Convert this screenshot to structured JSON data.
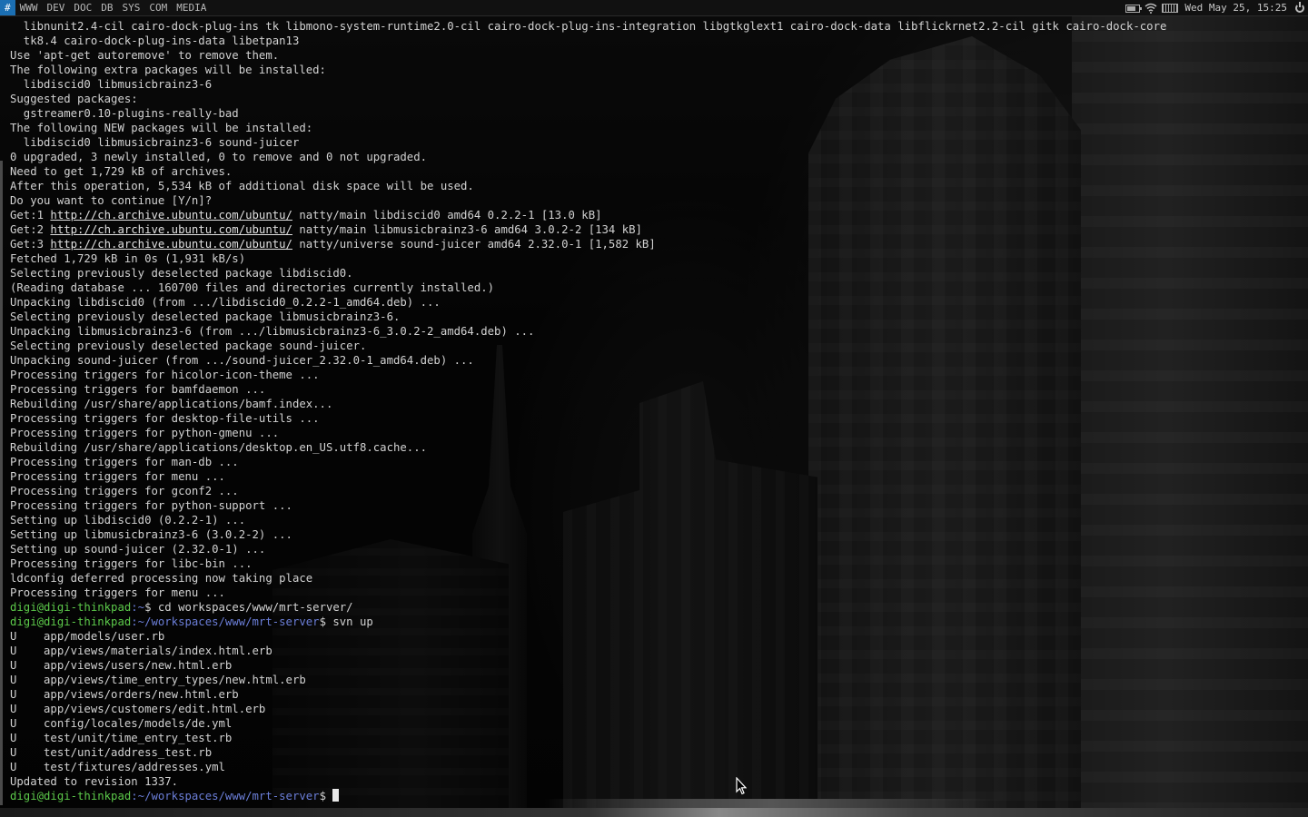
{
  "workspaces": [
    {
      "label": "#",
      "active": true
    },
    {
      "label": "WWW",
      "active": false
    },
    {
      "label": "DEV",
      "active": false
    },
    {
      "label": "DOC",
      "active": false
    },
    {
      "label": "DB",
      "active": false
    },
    {
      "label": "SYS",
      "active": false
    },
    {
      "label": "COM",
      "active": false
    },
    {
      "label": "MEDIA",
      "active": false
    }
  ],
  "tray": {
    "clock": "Wed May 25, 15:25",
    "icons": [
      "battery-icon",
      "wifi-icon",
      "keyboard-icon",
      "power-icon"
    ]
  },
  "colors": {
    "active_workspace": "#1b6fb3",
    "prompt_user": "#5cc94a",
    "prompt_path": "#6b7ed8",
    "terminal_text": "#d2d2d2"
  },
  "terminal": {
    "lines": [
      "  libnunit2.4-cil cairo-dock-plug-ins tk libmono-system-runtime2.0-cil cairo-dock-plug-ins-integration libgtkglext1 cairo-dock-data libflickrnet2.2-cil gitk cairo-dock-core",
      "  tk8.4 cairo-dock-plug-ins-data libetpan13",
      "Use 'apt-get autoremove' to remove them.",
      "The following extra packages will be installed:",
      "  libdiscid0 libmusicbrainz3-6",
      "Suggested packages:",
      "  gstreamer0.10-plugins-really-bad",
      "The following NEW packages will be installed:",
      "  libdiscid0 libmusicbrainz3-6 sound-juicer",
      "0 upgraded, 3 newly installed, 0 to remove and 0 not upgraded.",
      "Need to get 1,729 kB of archives.",
      "After this operation, 5,534 kB of additional disk space will be used.",
      "Do you want to continue [Y/n]?",
      {
        "prefix": "Get:1 ",
        "url": "http://ch.archive.ubuntu.com/ubuntu/",
        "suffix": " natty/main libdiscid0 amd64 0.2.2-1 [13.0 kB]"
      },
      {
        "prefix": "Get:2 ",
        "url": "http://ch.archive.ubuntu.com/ubuntu/",
        "suffix": " natty/main libmusicbrainz3-6 amd64 3.0.2-2 [134 kB]"
      },
      {
        "prefix": "Get:3 ",
        "url": "http://ch.archive.ubuntu.com/ubuntu/",
        "suffix": " natty/universe sound-juicer amd64 2.32.0-1 [1,582 kB]"
      },
      "Fetched 1,729 kB in 0s (1,931 kB/s)",
      "Selecting previously deselected package libdiscid0.",
      "(Reading database ... 160700 files and directories currently installed.)",
      "Unpacking libdiscid0 (from .../libdiscid0_0.2.2-1_amd64.deb) ...",
      "Selecting previously deselected package libmusicbrainz3-6.",
      "Unpacking libmusicbrainz3-6 (from .../libmusicbrainz3-6_3.0.2-2_amd64.deb) ...",
      "Selecting previously deselected package sound-juicer.",
      "Unpacking sound-juicer (from .../sound-juicer_2.32.0-1_amd64.deb) ...",
      "Processing triggers for hicolor-icon-theme ...",
      "Processing triggers for bamfdaemon ...",
      "Rebuilding /usr/share/applications/bamf.index...",
      "Processing triggers for desktop-file-utils ...",
      "Processing triggers for python-gmenu ...",
      "Rebuilding /usr/share/applications/desktop.en_US.utf8.cache...",
      "Processing triggers for man-db ...",
      "Processing triggers for menu ...",
      "Processing triggers for gconf2 ...",
      "Processing triggers for python-support ...",
      "Setting up libdiscid0 (0.2.2-1) ...",
      "Setting up libmusicbrainz3-6 (3.0.2-2) ...",
      "Setting up sound-juicer (2.32.0-1) ...",
      "Processing triggers for libc-bin ...",
      "ldconfig deferred processing now taking place",
      "Processing triggers for menu ...",
      {
        "user": "digi@digi-thinkpad",
        "path": ":~",
        "cmd": "$ cd workspaces/www/mrt-server/"
      },
      {
        "user": "digi@digi-thinkpad",
        "path": ":~/workspaces/www/mrt-server",
        "cmd": "$ svn up"
      },
      "U    app/models/user.rb",
      "U    app/views/materials/index.html.erb",
      "U    app/views/users/new.html.erb",
      "U    app/views/time_entry_types/new.html.erb",
      "U    app/views/orders/new.html.erb",
      "U    app/views/customers/edit.html.erb",
      "U    config/locales/models/de.yml",
      "U    test/unit/time_entry_test.rb",
      "U    test/unit/address_test.rb",
      "U    test/fixtures/addresses.yml",
      "Updated to revision 1337."
    ],
    "prompt": {
      "user": "digi@digi-thinkpad",
      "path": ":~/workspaces/www/mrt-server",
      "cmd": "$ "
    }
  }
}
